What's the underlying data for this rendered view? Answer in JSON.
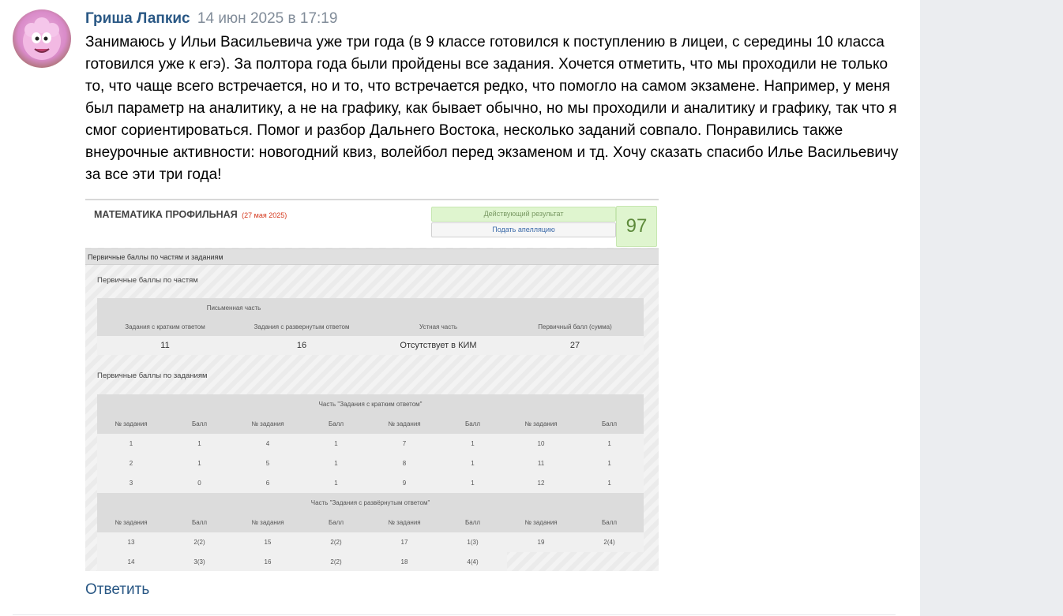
{
  "comment": {
    "author": "Гриша Лапкис",
    "date": "14 июн 2025 в 17:19",
    "text": "Занимаюсь у Ильи Васильевича уже три года (в 9 классе готовился к поступлению в лицеи, с середины 10 класса готовился уже к егэ). За полтора года были пройдены все задания. Хочется отметить, что мы проходили не только то, что чаще всего встречается, но и то, что встречается редко, что помогло на самом экзамене. Например, у меня был параметр на аналитику, а не на графику, как бывает обычно, но мы проходили и аналитику и графику, так что я смог сориентироваться. Помог и разбор Дальнего Востока, несколько заданий совпало. Понравились также внеурочные активности: новогодний квиз, волейбол перед экзаменом и тд. Хочу сказать спасибо Илье Васильевичу за все эти три года!",
    "reply_label": "Ответить",
    "avatar_icon": "smeshariki-nyusha-avatar"
  },
  "photo": {
    "subject": "МАТЕМАТИКА ПРОФИЛЬНАЯ",
    "subject_date": "(27 мая 2025)",
    "result_label": "Действующий результат",
    "appeal_label": "Подать апелляцию",
    "score": "97",
    "section_title": "Первичные баллы по частям и заданиям",
    "parts_label": "Первичные баллы по частям",
    "written_part": "Письменная часть",
    "parts_headers": [
      "Задания с кратким ответом",
      "Задания с развернутым ответом",
      "Устная часть",
      "Первичный балл (сумма)"
    ],
    "parts_values": [
      "11",
      "16",
      "Отсутствует в КИМ",
      "27"
    ],
    "tasks_label": "Первичные баллы по заданиям",
    "short_part_title": "Часть \"Задания с кратким ответом\"",
    "long_part_title": "Часть \"Задания с развёрнутым ответом\"",
    "col_task": "№ задания",
    "col_score": "Балл",
    "short_rows": [
      [
        "1",
        "1",
        "4",
        "1",
        "7",
        "1",
        "10",
        "1"
      ],
      [
        "2",
        "1",
        "5",
        "1",
        "8",
        "1",
        "11",
        "1"
      ],
      [
        "3",
        "0",
        "6",
        "1",
        "9",
        "1",
        "12",
        "1"
      ]
    ],
    "long_rows": [
      [
        "13",
        "2(2)",
        "15",
        "2(2)",
        "17",
        "1(3)",
        "19",
        "2(4)"
      ],
      [
        "14",
        "3(3)",
        "16",
        "2(2)",
        "18",
        "4(4)",
        "",
        ""
      ]
    ]
  },
  "colors": {
    "link": "#2a5885",
    "date": "#818c99",
    "sidebar": "#ebedf0",
    "score_green": "#dff5cf"
  }
}
